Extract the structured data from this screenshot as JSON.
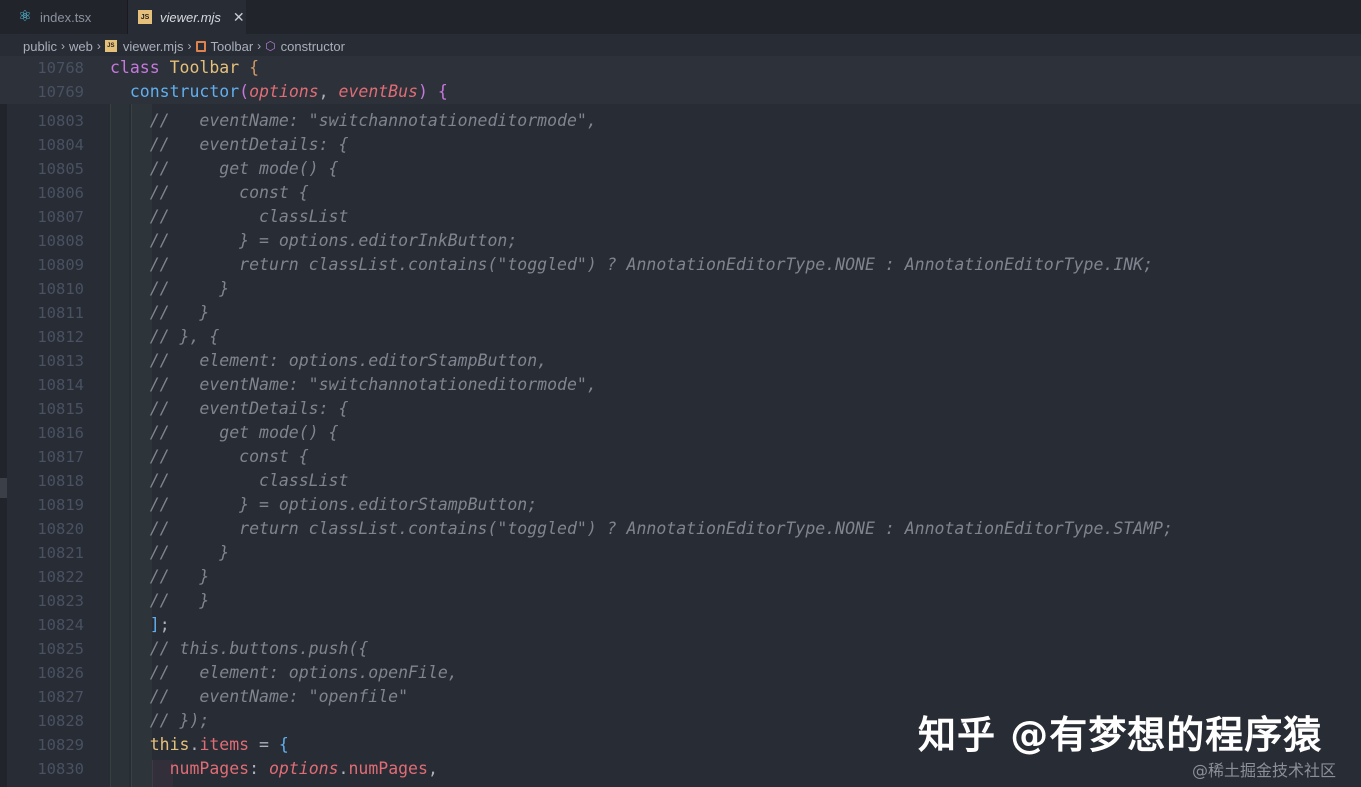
{
  "tabs": [
    {
      "label": "index.tsx",
      "icon": "react-icon"
    },
    {
      "label": "viewer.mjs",
      "icon": "js-file-icon",
      "active": true
    }
  ],
  "breadcrumb": {
    "items": [
      "public",
      "web",
      "viewer.mjs",
      "Toolbar",
      "constructor"
    ]
  },
  "editor": {
    "sticky": [
      {
        "num": "10768",
        "html": "<span class='k'>class</span> <span class='cls'>Toolbar</span> <span class='br'>{</span>"
      },
      {
        "num": "10769",
        "html": "  <span class='fn'>constructor</span><span class='brp'>(</span><span class='prm'>options</span><span class='p'>, </span><span class='prm'>eventBus</span><span class='brp'>)</span> <span class='brp'>{</span>"
      }
    ],
    "lines": [
      {
        "num": "10803",
        "html": "<span class='cm'>    //   eventName: \"switchannotationeditormode\",</span>"
      },
      {
        "num": "10804",
        "html": "<span class='cm'>    //   eventDetails: {</span>"
      },
      {
        "num": "10805",
        "html": "<span class='cm'>    //     get mode() {</span>"
      },
      {
        "num": "10806",
        "html": "<span class='cm'>    //       const {</span>"
      },
      {
        "num": "10807",
        "html": "<span class='cm'>    //         classList</span>"
      },
      {
        "num": "10808",
        "html": "<span class='cm'>    //       } = options.editorInkButton;</span>"
      },
      {
        "num": "10809",
        "html": "<span class='cm'>    //       return classList.contains(\"toggled\") ? AnnotationEditorType.NONE : AnnotationEditorType.INK;</span>"
      },
      {
        "num": "10810",
        "html": "<span class='cm'>    //     }</span>"
      },
      {
        "num": "10811",
        "html": "<span class='cm'>    //   }</span>"
      },
      {
        "num": "10812",
        "html": "<span class='cm'>    // }, {</span>"
      },
      {
        "num": "10813",
        "html": "<span class='cm'>    //   element: options.editorStampButton,</span>"
      },
      {
        "num": "10814",
        "html": "<span class='cm'>    //   eventName: \"switchannotationeditormode\",</span>"
      },
      {
        "num": "10815",
        "html": "<span class='cm'>    //   eventDetails: {</span>"
      },
      {
        "num": "10816",
        "html": "<span class='cm'>    //     get mode() {</span>"
      },
      {
        "num": "10817",
        "html": "<span class='cm'>    //       const {</span>"
      },
      {
        "num": "10818",
        "html": "<span class='cm'>    //         classList</span>"
      },
      {
        "num": "10819",
        "html": "<span class='cm'>    //       } = options.editorStampButton;</span>"
      },
      {
        "num": "10820",
        "html": "<span class='cm'>    //       return classList.contains(\"toggled\") ? AnnotationEditorType.NONE : AnnotationEditorType.STAMP;</span>"
      },
      {
        "num": "10821",
        "html": "<span class='cm'>    //     }</span>"
      },
      {
        "num": "10822",
        "html": "<span class='cm'>    //   }</span>"
      },
      {
        "num": "10823",
        "html": "<span class='cm'>    //   }</span>"
      },
      {
        "num": "10824",
        "html": "    <span class='brb'>]</span><span class='p'>;</span>"
      },
      {
        "num": "10825",
        "html": "<span class='cm'>    // this.buttons.push({</span>"
      },
      {
        "num": "10826",
        "html": "<span class='cm'>    //   element: options.openFile,</span>"
      },
      {
        "num": "10827",
        "html": "<span class='cm'>    //   eventName: \"openfile\"</span>"
      },
      {
        "num": "10828",
        "html": "<span class='cm'>    // });</span>"
      },
      {
        "num": "10829",
        "html": "    <span class='cls'>this</span><span class='p'>.</span><span class='prop'>items</span> <span class='p'>=</span> <span class='brb'>{</span>"
      },
      {
        "num": "10830",
        "html": "      <span class='prop'>numPages</span><span class='p'>: </span><span class='prm'>options</span><span class='p'>.</span><span class='prop'>numPages</span><span class='p'>,</span>"
      }
    ]
  },
  "watermark": {
    "main": "知乎 @有梦想的程序猿",
    "sub": "@稀土掘金技术社区"
  },
  "colors": {
    "background": "#282c34",
    "keyword": "#c678dd",
    "class": "#e5c07b",
    "function": "#61afef",
    "parameter": "#e06c75",
    "comment": "#7f848e",
    "line_number": "#495162"
  }
}
